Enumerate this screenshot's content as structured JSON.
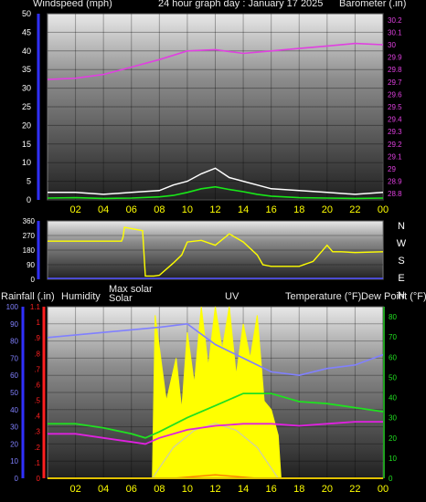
{
  "header": {
    "windspeed_label": "Windspeed (mph)",
    "graph_title": "24 hour graph day : January 17 2025",
    "barometer_label": "Barometer (.in)"
  },
  "panel3_header": {
    "rainfall": "Rainfall (.in)",
    "humidity": "Humidity",
    "max_solar": "Max solar",
    "solar": "Solar",
    "uv": "UV",
    "temperature": "Temperature (°F)",
    "dew_point": "Dew Point (°F)"
  },
  "colors": {
    "barometer": "#e040e0",
    "wind_avg": "#18e818",
    "wind_gust": "#ffffff",
    "direction": "#ffff00",
    "direction_axis": "#5050ff",
    "rain": "#ff2020",
    "humidity": "#8080ff",
    "solar": "#ffff00",
    "max_solar": "#d0d0a0",
    "uv": "#ff8000",
    "temperature": "#20e020",
    "dew_point": "#e020e0",
    "hour_labels": "#ffff00"
  },
  "chart_data": [
    {
      "type": "line",
      "panel": "wind-barometer",
      "x_ticks": [
        "02",
        "04",
        "06",
        "08",
        "10",
        "12",
        "14",
        "16",
        "18",
        "20",
        "22",
        "00"
      ],
      "y_left_ticks": [
        "0",
        "5",
        "10",
        "15",
        "20",
        "25",
        "30",
        "35",
        "40",
        "45",
        "50"
      ],
      "y_left_range": [
        0,
        50
      ],
      "y_right_ticks": [
        "28.8",
        "28.9",
        "29",
        "29.1",
        "29.2",
        "29.3",
        "29.4",
        "29.5",
        "29.6",
        "29.7",
        "29.8",
        "29.9",
        "30",
        "30.1",
        "30.2"
      ],
      "y_right_range": [
        28.75,
        30.25
      ],
      "series": [
        {
          "name": "Barometer",
          "x": [
            0,
            2,
            4,
            6,
            8,
            10,
            12,
            14,
            16,
            18,
            20,
            22,
            24
          ],
          "values": [
            29.72,
            29.73,
            29.76,
            29.82,
            29.88,
            29.95,
            29.96,
            29.93,
            29.95,
            29.97,
            29.99,
            30.01,
            30.0
          ]
        },
        {
          "name": "Wind average",
          "x": [
            0,
            2,
            4,
            6,
            8,
            9,
            10,
            11,
            12,
            13,
            14,
            15,
            16,
            18,
            20,
            22,
            24
          ],
          "values": [
            0.5,
            0.6,
            0.4,
            0.5,
            0.8,
            1.2,
            2,
            3,
            3.5,
            2.8,
            2.2,
            1.5,
            1,
            0.6,
            0.5,
            0.4,
            0.5
          ]
        },
        {
          "name": "Wind gust",
          "x": [
            0,
            2,
            4,
            6,
            8,
            9,
            10,
            11,
            12,
            13,
            14,
            15,
            16,
            18,
            20,
            22,
            24
          ],
          "values": [
            2,
            2,
            1.5,
            2,
            2.5,
            4,
            5,
            7,
            8.5,
            6,
            5,
            4,
            3,
            2.5,
            2,
            1.5,
            2
          ]
        }
      ]
    },
    {
      "type": "line",
      "panel": "wind-direction",
      "x_range": [
        0,
        24
      ],
      "y_left_ticks": [
        "0",
        "90",
        "180",
        "270",
        "360"
      ],
      "y_left_range": [
        0,
        360
      ],
      "y_right_ticks": [
        "N",
        "W",
        "S",
        "E",
        "N"
      ],
      "series": [
        {
          "name": "Wind direction",
          "x": [
            0,
            3,
            5.3,
            5.4,
            5.5,
            6.8,
            7,
            7.6,
            8,
            9,
            9.6,
            10,
            11,
            12,
            13,
            14,
            15,
            15.4,
            16,
            17,
            18,
            19,
            20,
            20.4,
            21,
            22,
            24
          ],
          "values": [
            235,
            235,
            235,
            260,
            320,
            300,
            20,
            20,
            25,
            100,
            150,
            230,
            240,
            210,
            280,
            230,
            150,
            90,
            80,
            80,
            80,
            110,
            210,
            170,
            170,
            165,
            170
          ]
        }
      ]
    },
    {
      "type": "line",
      "panel": "solar-temperature",
      "x_ticks": [
        "02",
        "04",
        "06",
        "08",
        "10",
        "12",
        "14",
        "16",
        "18",
        "20",
        "22",
        "00"
      ],
      "y_rain_ticks": [
        "0",
        ".1",
        ".2",
        ".3",
        ".4",
        ".5",
        ".6",
        ".7",
        ".8",
        ".9",
        "1",
        "1.1"
      ],
      "y_rain_range": [
        0,
        1.1
      ],
      "y_humidity_ticks": [
        "0",
        "10",
        "20",
        "30",
        "40",
        "50",
        "60",
        "70",
        "80",
        "90",
        "100"
      ],
      "y_humidity_range": [
        0,
        100
      ],
      "y_temperature_ticks": [
        "0",
        "10",
        "20",
        "30",
        "40",
        "50",
        "60",
        "70",
        "80"
      ],
      "y_temperature_range": [
        0,
        85
      ],
      "series": [
        {
          "name": "Humidity",
          "x": [
            0,
            4,
            8,
            10,
            12,
            14,
            16,
            18,
            20,
            22,
            24
          ],
          "values": [
            82,
            85,
            88,
            90,
            78,
            70,
            62,
            60,
            64,
            66,
            72
          ]
        },
        {
          "name": "Max solar",
          "x": [
            7.5,
            9,
            10.5,
            12,
            13.5,
            15,
            16.5
          ],
          "values": [
            0,
            18,
            28,
            32,
            28,
            18,
            0
          ]
        },
        {
          "name": "Solar",
          "x": [
            7.5,
            7.7,
            8.5,
            9.2,
            9.6,
            10,
            10.5,
            11,
            11.5,
            12,
            12.5,
            13,
            13.5,
            14,
            14.5,
            15,
            15.5,
            16,
            16.5,
            16.7
          ],
          "values": [
            0,
            95,
            45,
            70,
            40,
            85,
            55,
            100,
            65,
            100,
            75,
            100,
            60,
            90,
            70,
            95,
            45,
            40,
            25,
            0
          ]
        },
        {
          "name": "UV",
          "x": [
            9,
            10.5,
            12,
            13.5,
            15
          ],
          "values": [
            0,
            1,
            2,
            1,
            0
          ]
        },
        {
          "name": "Temperature",
          "x": [
            0,
            2,
            4,
            6,
            7,
            8,
            10,
            12,
            14,
            16,
            18,
            20,
            22,
            24
          ],
          "values": [
            27,
            27,
            25,
            22,
            20,
            23,
            30,
            36,
            42,
            42,
            38,
            37,
            35,
            33
          ]
        },
        {
          "name": "Dew Point",
          "x": [
            0,
            2,
            4,
            6,
            7,
            8,
            10,
            12,
            14,
            16,
            18,
            20,
            22,
            24
          ],
          "values": [
            22,
            22,
            20,
            18,
            17,
            20,
            24,
            26,
            27,
            27,
            26,
            27,
            28,
            28
          ]
        },
        {
          "name": "Rainfall",
          "x": [
            0,
            24
          ],
          "values": [
            0,
            0
          ]
        }
      ]
    }
  ]
}
